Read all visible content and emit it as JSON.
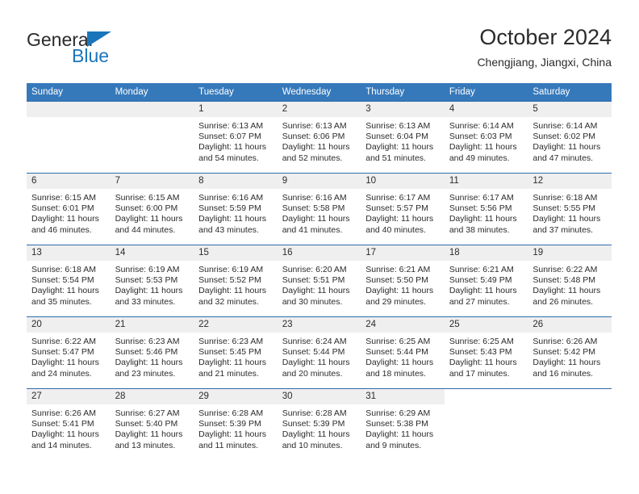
{
  "brand": {
    "name_part1": "General",
    "name_part2": "Blue"
  },
  "header": {
    "title": "October 2024",
    "location": "Chengjiang, Jiangxi, China"
  },
  "colors": {
    "header_blue": "#3679bb",
    "row_divider_blue": "#2f6cab",
    "daynum_band": "#efefef",
    "brand_blue": "#1b75bb",
    "text": "#2b2b2b"
  },
  "weekday_headers": [
    "Sunday",
    "Monday",
    "Tuesday",
    "Wednesday",
    "Thursday",
    "Friday",
    "Saturday"
  ],
  "weeks": [
    [
      {
        "day": "",
        "blank": true
      },
      {
        "day": "",
        "blank": true
      },
      {
        "day": "1",
        "sunrise": "Sunrise: 6:13 AM",
        "sunset": "Sunset: 6:07 PM",
        "daylight_line1": "Daylight: 11 hours",
        "daylight_line2": "and 54 minutes."
      },
      {
        "day": "2",
        "sunrise": "Sunrise: 6:13 AM",
        "sunset": "Sunset: 6:06 PM",
        "daylight_line1": "Daylight: 11 hours",
        "daylight_line2": "and 52 minutes."
      },
      {
        "day": "3",
        "sunrise": "Sunrise: 6:13 AM",
        "sunset": "Sunset: 6:04 PM",
        "daylight_line1": "Daylight: 11 hours",
        "daylight_line2": "and 51 minutes."
      },
      {
        "day": "4",
        "sunrise": "Sunrise: 6:14 AM",
        "sunset": "Sunset: 6:03 PM",
        "daylight_line1": "Daylight: 11 hours",
        "daylight_line2": "and 49 minutes."
      },
      {
        "day": "5",
        "sunrise": "Sunrise: 6:14 AM",
        "sunset": "Sunset: 6:02 PM",
        "daylight_line1": "Daylight: 11 hours",
        "daylight_line2": "and 47 minutes."
      }
    ],
    [
      {
        "day": "6",
        "sunrise": "Sunrise: 6:15 AM",
        "sunset": "Sunset: 6:01 PM",
        "daylight_line1": "Daylight: 11 hours",
        "daylight_line2": "and 46 minutes."
      },
      {
        "day": "7",
        "sunrise": "Sunrise: 6:15 AM",
        "sunset": "Sunset: 6:00 PM",
        "daylight_line1": "Daylight: 11 hours",
        "daylight_line2": "and 44 minutes."
      },
      {
        "day": "8",
        "sunrise": "Sunrise: 6:16 AM",
        "sunset": "Sunset: 5:59 PM",
        "daylight_line1": "Daylight: 11 hours",
        "daylight_line2": "and 43 minutes."
      },
      {
        "day": "9",
        "sunrise": "Sunrise: 6:16 AM",
        "sunset": "Sunset: 5:58 PM",
        "daylight_line1": "Daylight: 11 hours",
        "daylight_line2": "and 41 minutes."
      },
      {
        "day": "10",
        "sunrise": "Sunrise: 6:17 AM",
        "sunset": "Sunset: 5:57 PM",
        "daylight_line1": "Daylight: 11 hours",
        "daylight_line2": "and 40 minutes."
      },
      {
        "day": "11",
        "sunrise": "Sunrise: 6:17 AM",
        "sunset": "Sunset: 5:56 PM",
        "daylight_line1": "Daylight: 11 hours",
        "daylight_line2": "and 38 minutes."
      },
      {
        "day": "12",
        "sunrise": "Sunrise: 6:18 AM",
        "sunset": "Sunset: 5:55 PM",
        "daylight_line1": "Daylight: 11 hours",
        "daylight_line2": "and 37 minutes."
      }
    ],
    [
      {
        "day": "13",
        "sunrise": "Sunrise: 6:18 AM",
        "sunset": "Sunset: 5:54 PM",
        "daylight_line1": "Daylight: 11 hours",
        "daylight_line2": "and 35 minutes."
      },
      {
        "day": "14",
        "sunrise": "Sunrise: 6:19 AM",
        "sunset": "Sunset: 5:53 PM",
        "daylight_line1": "Daylight: 11 hours",
        "daylight_line2": "and 33 minutes."
      },
      {
        "day": "15",
        "sunrise": "Sunrise: 6:19 AM",
        "sunset": "Sunset: 5:52 PM",
        "daylight_line1": "Daylight: 11 hours",
        "daylight_line2": "and 32 minutes."
      },
      {
        "day": "16",
        "sunrise": "Sunrise: 6:20 AM",
        "sunset": "Sunset: 5:51 PM",
        "daylight_line1": "Daylight: 11 hours",
        "daylight_line2": "and 30 minutes."
      },
      {
        "day": "17",
        "sunrise": "Sunrise: 6:21 AM",
        "sunset": "Sunset: 5:50 PM",
        "daylight_line1": "Daylight: 11 hours",
        "daylight_line2": "and 29 minutes."
      },
      {
        "day": "18",
        "sunrise": "Sunrise: 6:21 AM",
        "sunset": "Sunset: 5:49 PM",
        "daylight_line1": "Daylight: 11 hours",
        "daylight_line2": "and 27 minutes."
      },
      {
        "day": "19",
        "sunrise": "Sunrise: 6:22 AM",
        "sunset": "Sunset: 5:48 PM",
        "daylight_line1": "Daylight: 11 hours",
        "daylight_line2": "and 26 minutes."
      }
    ],
    [
      {
        "day": "20",
        "sunrise": "Sunrise: 6:22 AM",
        "sunset": "Sunset: 5:47 PM",
        "daylight_line1": "Daylight: 11 hours",
        "daylight_line2": "and 24 minutes."
      },
      {
        "day": "21",
        "sunrise": "Sunrise: 6:23 AM",
        "sunset": "Sunset: 5:46 PM",
        "daylight_line1": "Daylight: 11 hours",
        "daylight_line2": "and 23 minutes."
      },
      {
        "day": "22",
        "sunrise": "Sunrise: 6:23 AM",
        "sunset": "Sunset: 5:45 PM",
        "daylight_line1": "Daylight: 11 hours",
        "daylight_line2": "and 21 minutes."
      },
      {
        "day": "23",
        "sunrise": "Sunrise: 6:24 AM",
        "sunset": "Sunset: 5:44 PM",
        "daylight_line1": "Daylight: 11 hours",
        "daylight_line2": "and 20 minutes."
      },
      {
        "day": "24",
        "sunrise": "Sunrise: 6:25 AM",
        "sunset": "Sunset: 5:44 PM",
        "daylight_line1": "Daylight: 11 hours",
        "daylight_line2": "and 18 minutes."
      },
      {
        "day": "25",
        "sunrise": "Sunrise: 6:25 AM",
        "sunset": "Sunset: 5:43 PM",
        "daylight_line1": "Daylight: 11 hours",
        "daylight_line2": "and 17 minutes."
      },
      {
        "day": "26",
        "sunrise": "Sunrise: 6:26 AM",
        "sunset": "Sunset: 5:42 PM",
        "daylight_line1": "Daylight: 11 hours",
        "daylight_line2": "and 16 minutes."
      }
    ],
    [
      {
        "day": "27",
        "sunrise": "Sunrise: 6:26 AM",
        "sunset": "Sunset: 5:41 PM",
        "daylight_line1": "Daylight: 11 hours",
        "daylight_line2": "and 14 minutes."
      },
      {
        "day": "28",
        "sunrise": "Sunrise: 6:27 AM",
        "sunset": "Sunset: 5:40 PM",
        "daylight_line1": "Daylight: 11 hours",
        "daylight_line2": "and 13 minutes."
      },
      {
        "day": "29",
        "sunrise": "Sunrise: 6:28 AM",
        "sunset": "Sunset: 5:39 PM",
        "daylight_line1": "Daylight: 11 hours",
        "daylight_line2": "and 11 minutes."
      },
      {
        "day": "30",
        "sunrise": "Sunrise: 6:28 AM",
        "sunset": "Sunset: 5:39 PM",
        "daylight_line1": "Daylight: 11 hours",
        "daylight_line2": "and 10 minutes."
      },
      {
        "day": "31",
        "sunrise": "Sunrise: 6:29 AM",
        "sunset": "Sunset: 5:38 PM",
        "daylight_line1": "Daylight: 11 hours",
        "daylight_line2": "and 9 minutes."
      },
      {
        "day": "",
        "blank": true,
        "noband": true
      },
      {
        "day": "",
        "blank": true,
        "noband": true
      }
    ]
  ]
}
